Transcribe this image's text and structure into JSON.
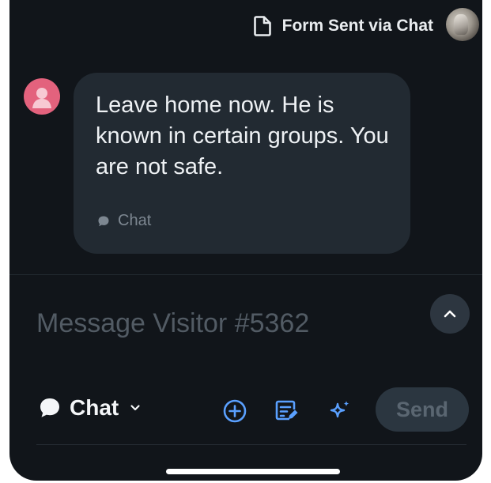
{
  "header": {
    "form_status": "Form Sent via Chat",
    "form_icon": "document-icon",
    "avatar_icon": "user-photo"
  },
  "conversation": {
    "messages": [
      {
        "sender_avatar": "person-icon",
        "sender_avatar_color": "#e3627d",
        "text": "Leave home now. He is known in certain groups. You are not safe.",
        "source_label": "Chat",
        "source_icon": "chat-bubble-icon"
      }
    ]
  },
  "composer": {
    "placeholder": "Message Visitor #5362",
    "value": "",
    "channel_label": "Chat",
    "channel_icon": "chat-bubble-icon",
    "send_label": "Send",
    "tools": [
      "add-icon",
      "canned-reply-icon",
      "ai-sparkle-icon"
    ]
  },
  "colors": {
    "background": "#11151a",
    "bubble": "#222a32",
    "accent": "#5aa0ff",
    "send_disabled_bg": "#2b3640"
  }
}
